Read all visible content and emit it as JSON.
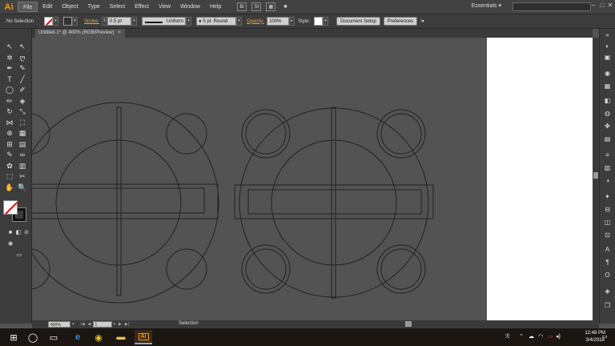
{
  "app": {
    "logo": "Ai"
  },
  "menu": [
    "File",
    "Edit",
    "Object",
    "Type",
    "Select",
    "Effect",
    "View",
    "Window",
    "Help"
  ],
  "menubar": {
    "bridge_icon": "Br",
    "stock_icon": "St",
    "workspace": "Essentials ▾",
    "minimize": "–",
    "maximize": "□",
    "close": "✕"
  },
  "control": {
    "selection_label": "No Selection",
    "stroke_label": "Stroke:",
    "stroke_weight": "0.5 pt",
    "stroke_profile": "Uniform",
    "brush": "5 pt. Round",
    "opacity_label": "Opacity:",
    "opacity_value": "100%",
    "style_label": "Style:",
    "doc_setup": "Document Setup",
    "preferences": "Preferences"
  },
  "document": {
    "tab_title": "Untitled-1* @ 400% (RGB/Preview)",
    "close": "✕"
  },
  "tools": [
    {
      "name": "selection-tool",
      "glyph": "↖"
    },
    {
      "name": "direct-selection-tool",
      "glyph": "↖"
    },
    {
      "name": "magic-wand-tool",
      "glyph": "✲"
    },
    {
      "name": "lasso-tool",
      "glyph": "ღ"
    },
    {
      "name": "pen-tool",
      "glyph": "✒"
    },
    {
      "name": "curvature-tool",
      "glyph": "✎"
    },
    {
      "name": "type-tool",
      "glyph": "T"
    },
    {
      "name": "line-tool",
      "glyph": "╱"
    },
    {
      "name": "ellipse-tool",
      "glyph": "◯"
    },
    {
      "name": "paintbrush-tool",
      "glyph": "✐"
    },
    {
      "name": "shaper-tool",
      "glyph": "✏"
    },
    {
      "name": "eraser-tool",
      "glyph": "◈"
    },
    {
      "name": "rotate-tool",
      "glyph": "↻"
    },
    {
      "name": "scale-tool",
      "glyph": "⤡"
    },
    {
      "name": "width-tool",
      "glyph": "⋈"
    },
    {
      "name": "free-transform-tool",
      "glyph": "⛶"
    },
    {
      "name": "shape-builder-tool",
      "glyph": "⊕"
    },
    {
      "name": "perspective-tool",
      "glyph": "▦"
    },
    {
      "name": "mesh-tool",
      "glyph": "⊞"
    },
    {
      "name": "gradient-tool",
      "glyph": "▤"
    },
    {
      "name": "eyedropper-tool",
      "glyph": "✎"
    },
    {
      "name": "blend-tool",
      "glyph": "∞"
    },
    {
      "name": "symbol-sprayer-tool",
      "glyph": "✿"
    },
    {
      "name": "column-graph-tool",
      "glyph": "▥"
    },
    {
      "name": "artboard-tool",
      "glyph": "⬚"
    },
    {
      "name": "slice-tool",
      "glyph": "✂"
    },
    {
      "name": "hand-tool",
      "glyph": "✋"
    },
    {
      "name": "zoom-tool",
      "glyph": "🔍"
    }
  ],
  "status": {
    "zoom": "400%",
    "page": "1",
    "mode": "Selection",
    "prev": "◀",
    "next": "▶"
  },
  "taskbar": {
    "start": "⊞",
    "search": "◯",
    "task_view": "▭",
    "edge": "e",
    "chrome": "◉",
    "explorer": "▬",
    "ai": "Ai",
    "time": "12:48 PM",
    "date": "3/4/2018"
  },
  "colors": {
    "artboard": "#ffffff",
    "pasteboard": "#535353",
    "accent": "#ff9a00"
  }
}
